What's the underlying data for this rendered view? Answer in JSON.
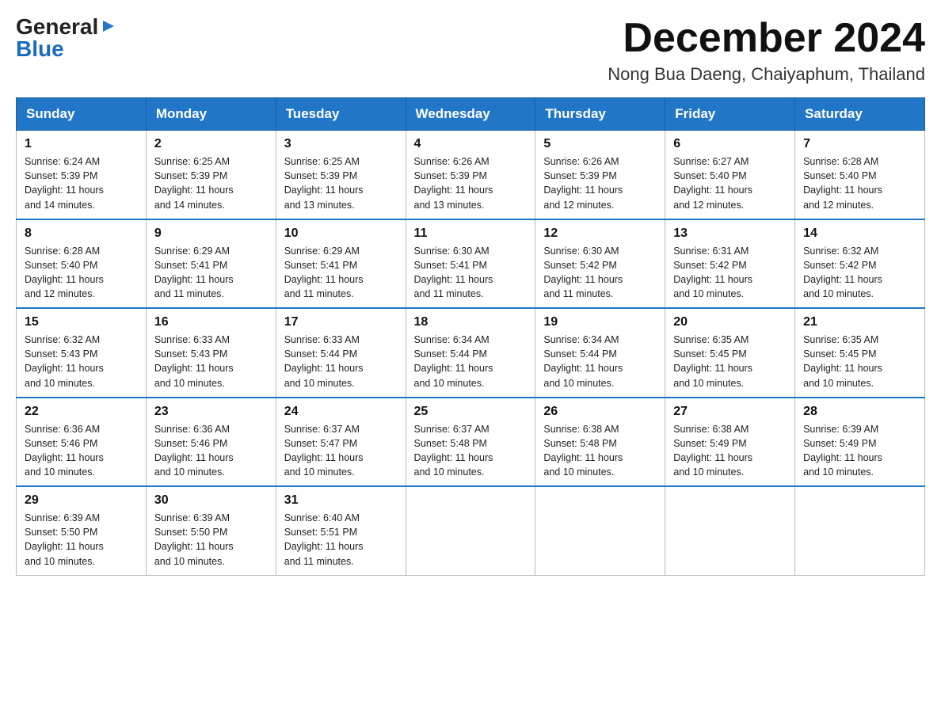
{
  "logo": {
    "general": "General",
    "arrow": "▶",
    "blue": "Blue"
  },
  "title": {
    "month": "December 2024",
    "location": "Nong Bua Daeng, Chaiyaphum, Thailand"
  },
  "headers": [
    "Sunday",
    "Monday",
    "Tuesday",
    "Wednesday",
    "Thursday",
    "Friday",
    "Saturday"
  ],
  "weeks": [
    [
      {
        "day": "1",
        "sunrise": "6:24 AM",
        "sunset": "5:39 PM",
        "daylight": "11 hours and 14 minutes."
      },
      {
        "day": "2",
        "sunrise": "6:25 AM",
        "sunset": "5:39 PM",
        "daylight": "11 hours and 14 minutes."
      },
      {
        "day": "3",
        "sunrise": "6:25 AM",
        "sunset": "5:39 PM",
        "daylight": "11 hours and 13 minutes."
      },
      {
        "day": "4",
        "sunrise": "6:26 AM",
        "sunset": "5:39 PM",
        "daylight": "11 hours and 13 minutes."
      },
      {
        "day": "5",
        "sunrise": "6:26 AM",
        "sunset": "5:39 PM",
        "daylight": "11 hours and 12 minutes."
      },
      {
        "day": "6",
        "sunrise": "6:27 AM",
        "sunset": "5:40 PM",
        "daylight": "11 hours and 12 minutes."
      },
      {
        "day": "7",
        "sunrise": "6:28 AM",
        "sunset": "5:40 PM",
        "daylight": "11 hours and 12 minutes."
      }
    ],
    [
      {
        "day": "8",
        "sunrise": "6:28 AM",
        "sunset": "5:40 PM",
        "daylight": "11 hours and 12 minutes."
      },
      {
        "day": "9",
        "sunrise": "6:29 AM",
        "sunset": "5:41 PM",
        "daylight": "11 hours and 11 minutes."
      },
      {
        "day": "10",
        "sunrise": "6:29 AM",
        "sunset": "5:41 PM",
        "daylight": "11 hours and 11 minutes."
      },
      {
        "day": "11",
        "sunrise": "6:30 AM",
        "sunset": "5:41 PM",
        "daylight": "11 hours and 11 minutes."
      },
      {
        "day": "12",
        "sunrise": "6:30 AM",
        "sunset": "5:42 PM",
        "daylight": "11 hours and 11 minutes."
      },
      {
        "day": "13",
        "sunrise": "6:31 AM",
        "sunset": "5:42 PM",
        "daylight": "11 hours and 10 minutes."
      },
      {
        "day": "14",
        "sunrise": "6:32 AM",
        "sunset": "5:42 PM",
        "daylight": "11 hours and 10 minutes."
      }
    ],
    [
      {
        "day": "15",
        "sunrise": "6:32 AM",
        "sunset": "5:43 PM",
        "daylight": "11 hours and 10 minutes."
      },
      {
        "day": "16",
        "sunrise": "6:33 AM",
        "sunset": "5:43 PM",
        "daylight": "11 hours and 10 minutes."
      },
      {
        "day": "17",
        "sunrise": "6:33 AM",
        "sunset": "5:44 PM",
        "daylight": "11 hours and 10 minutes."
      },
      {
        "day": "18",
        "sunrise": "6:34 AM",
        "sunset": "5:44 PM",
        "daylight": "11 hours and 10 minutes."
      },
      {
        "day": "19",
        "sunrise": "6:34 AM",
        "sunset": "5:44 PM",
        "daylight": "11 hours and 10 minutes."
      },
      {
        "day": "20",
        "sunrise": "6:35 AM",
        "sunset": "5:45 PM",
        "daylight": "11 hours and 10 minutes."
      },
      {
        "day": "21",
        "sunrise": "6:35 AM",
        "sunset": "5:45 PM",
        "daylight": "11 hours and 10 minutes."
      }
    ],
    [
      {
        "day": "22",
        "sunrise": "6:36 AM",
        "sunset": "5:46 PM",
        "daylight": "11 hours and 10 minutes."
      },
      {
        "day": "23",
        "sunrise": "6:36 AM",
        "sunset": "5:46 PM",
        "daylight": "11 hours and 10 minutes."
      },
      {
        "day": "24",
        "sunrise": "6:37 AM",
        "sunset": "5:47 PM",
        "daylight": "11 hours and 10 minutes."
      },
      {
        "day": "25",
        "sunrise": "6:37 AM",
        "sunset": "5:48 PM",
        "daylight": "11 hours and 10 minutes."
      },
      {
        "day": "26",
        "sunrise": "6:38 AM",
        "sunset": "5:48 PM",
        "daylight": "11 hours and 10 minutes."
      },
      {
        "day": "27",
        "sunrise": "6:38 AM",
        "sunset": "5:49 PM",
        "daylight": "11 hours and 10 minutes."
      },
      {
        "day": "28",
        "sunrise": "6:39 AM",
        "sunset": "5:49 PM",
        "daylight": "11 hours and 10 minutes."
      }
    ],
    [
      {
        "day": "29",
        "sunrise": "6:39 AM",
        "sunset": "5:50 PM",
        "daylight": "11 hours and 10 minutes."
      },
      {
        "day": "30",
        "sunrise": "6:39 AM",
        "sunset": "5:50 PM",
        "daylight": "11 hours and 10 minutes."
      },
      {
        "day": "31",
        "sunrise": "6:40 AM",
        "sunset": "5:51 PM",
        "daylight": "11 hours and 11 minutes."
      },
      null,
      null,
      null,
      null
    ]
  ],
  "labels": {
    "sunrise_prefix": "Sunrise: ",
    "sunset_prefix": "Sunset: ",
    "daylight_prefix": "Daylight: "
  }
}
